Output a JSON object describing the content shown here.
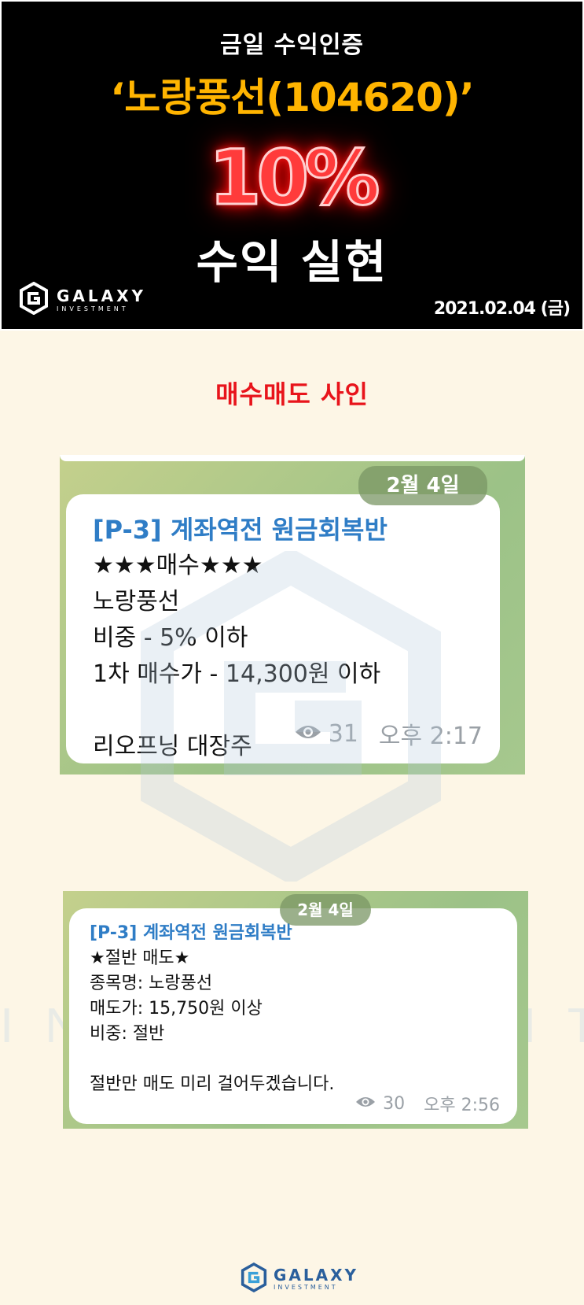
{
  "banner": {
    "eyebrow": "금일 수익인증",
    "stock": "‘노랑풍선(104620)’",
    "percent": "10%",
    "realize": "수익 실현",
    "logo_main": "GALAXY",
    "logo_sub": "INVESTMENT",
    "date": "2021.02.04 (금)"
  },
  "section": {
    "title": "매수매도 사인"
  },
  "message1": {
    "date_pill": "2월 4일",
    "channel": "[P-3] 계좌역전 원금회복반",
    "lines": [
      "★★★매수★★★",
      "노랑풍선",
      "비중 - 5% 이하",
      "1차 매수가 - 14,300원 이하"
    ],
    "footer_line": "리오프닝 대장주",
    "views": "31",
    "time": "오후 2:17"
  },
  "message2": {
    "date_pill": "2월 4일",
    "channel": "[P-3] 계좌역전 원금회복반",
    "lines": [
      "★절반 매도★",
      "종목명: 노랑풍선",
      "매도가: 15,750원 이상",
      "비중: 절반"
    ],
    "footer_line": "절반만 매도 미리 걸어두겠습니다.",
    "views": "30",
    "time": "오후 2:56"
  },
  "footer": {
    "logo_main": "GALAXY",
    "logo_sub": "INVESTMENT"
  },
  "colors": {
    "background": "#fdf6e6",
    "stock_name": "#ffb400",
    "percent": "#ff3b3b",
    "section_title": "#e8141b",
    "channel": "#2f7dc6"
  },
  "icons": [
    "galaxy-logo-icon",
    "eye-icon"
  ]
}
